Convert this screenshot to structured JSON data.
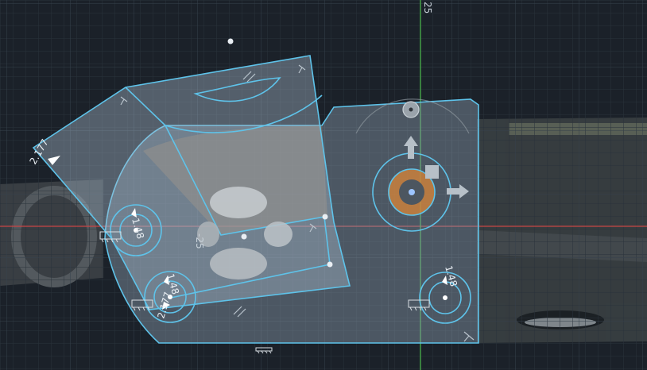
{
  "viewport": {
    "axis_label_vertical": "25",
    "axis_label_sketch": "-25"
  },
  "dimensions": {
    "angle_dim_top": "2.177",
    "hole_left_dim": "1.48",
    "hole_bottom_left_dim": "1.48",
    "hole_bottom_left_dim2": "2.177",
    "hole_right_dim": "1.48"
  },
  "colors": {
    "sketch_line": "#5ec3ea",
    "sketch_fill": "#a9bdd0",
    "background": "#1a2028",
    "grid_minor": "#2c3640",
    "grid_major": "#394551",
    "axis_red": "#c74545",
    "axis_green": "#48b848",
    "manipulator": "#b7c0c8"
  },
  "icons": {
    "move_up_arrow": "arrow-up-icon",
    "move_right_arrow": "arrow-right-icon",
    "rotate_handle": "rotate-handle-icon",
    "plane_handle": "plane-handle-icon",
    "origin_point": "origin-point-icon",
    "constraint_parallel": "parallel-constraint-icon",
    "constraint_perpendicular": "perpendicular-constraint-icon",
    "constraint_fix": "fix-constraint-icon",
    "constraint_horizontal": "horizontal-constraint-icon"
  }
}
